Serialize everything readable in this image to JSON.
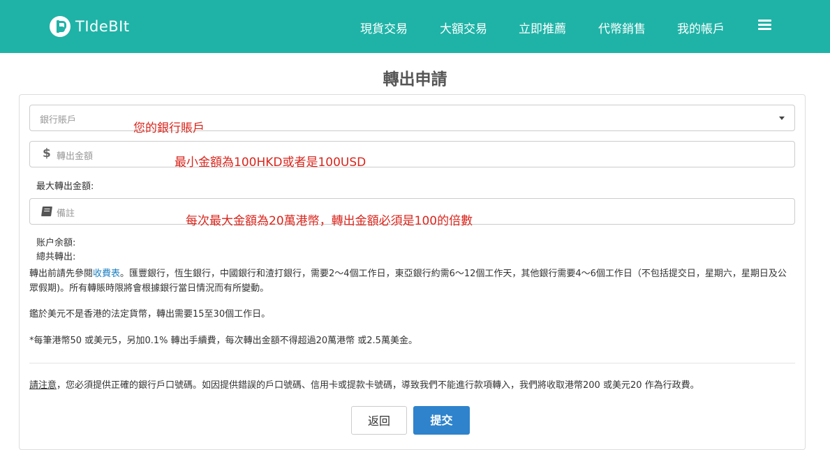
{
  "header": {
    "logo_text": "TIdeBIt",
    "nav": [
      "現貨交易",
      "大額交易",
      "立即推薦",
      "代幣銷售",
      "我的帳戶"
    ],
    "menu_icon": "hamburger-icon"
  },
  "page": {
    "title": "轉出申請"
  },
  "form": {
    "bank_account_placeholder": "銀行賬戶",
    "amount_placeholder": "轉出金額",
    "note_placeholder": "備註",
    "max_amount_label": "最大轉出金額:",
    "balance_label": "账户余額:",
    "total_label": "總共轉出:"
  },
  "annotations": {
    "bank": "您的銀行賬戶",
    "amount": "最小金額為100HKD或者是100USD",
    "note": "每次最大金額為20萬港幣，轉出金額必須是100的倍數"
  },
  "notes": {
    "p1_before": "轉出前請先參閱",
    "p1_link": "收費表",
    "p1_after": "。匯豐銀行，恆生銀行，中國銀行和渣打銀行，需要2～4個工作日，東亞銀行約需6～12個工作天，其他銀行需要4～6個工作日（不包括提交日，星期六，星期日及公眾假期)。所有轉賬時限將會根據銀行當日情況而有所變動。",
    "p2": "鑑於美元不是香港的法定貨幣，轉出需要15至30個工作日。",
    "p3": "*每筆港幣50 或美元5，另加0.1% 轉出手續費，每次轉出金額不得超過20萬港幣 或2.5萬美金。",
    "warning_label": "請注意",
    "warning_text": "，您必須提供正確的銀行戶口號碼。如因提供錯誤的戶口號碼、信用卡或提款卡號碼，導致我們不能進行款項轉入，我們將收取港幣200 或美元20 作為行政費。"
  },
  "buttons": {
    "back": "返回",
    "submit": "提交"
  },
  "colors": {
    "header_bg": "#1fb3a7",
    "annotation": "#d9251c",
    "submit_bg": "#2e83cc",
    "link": "#1a7fc1"
  }
}
